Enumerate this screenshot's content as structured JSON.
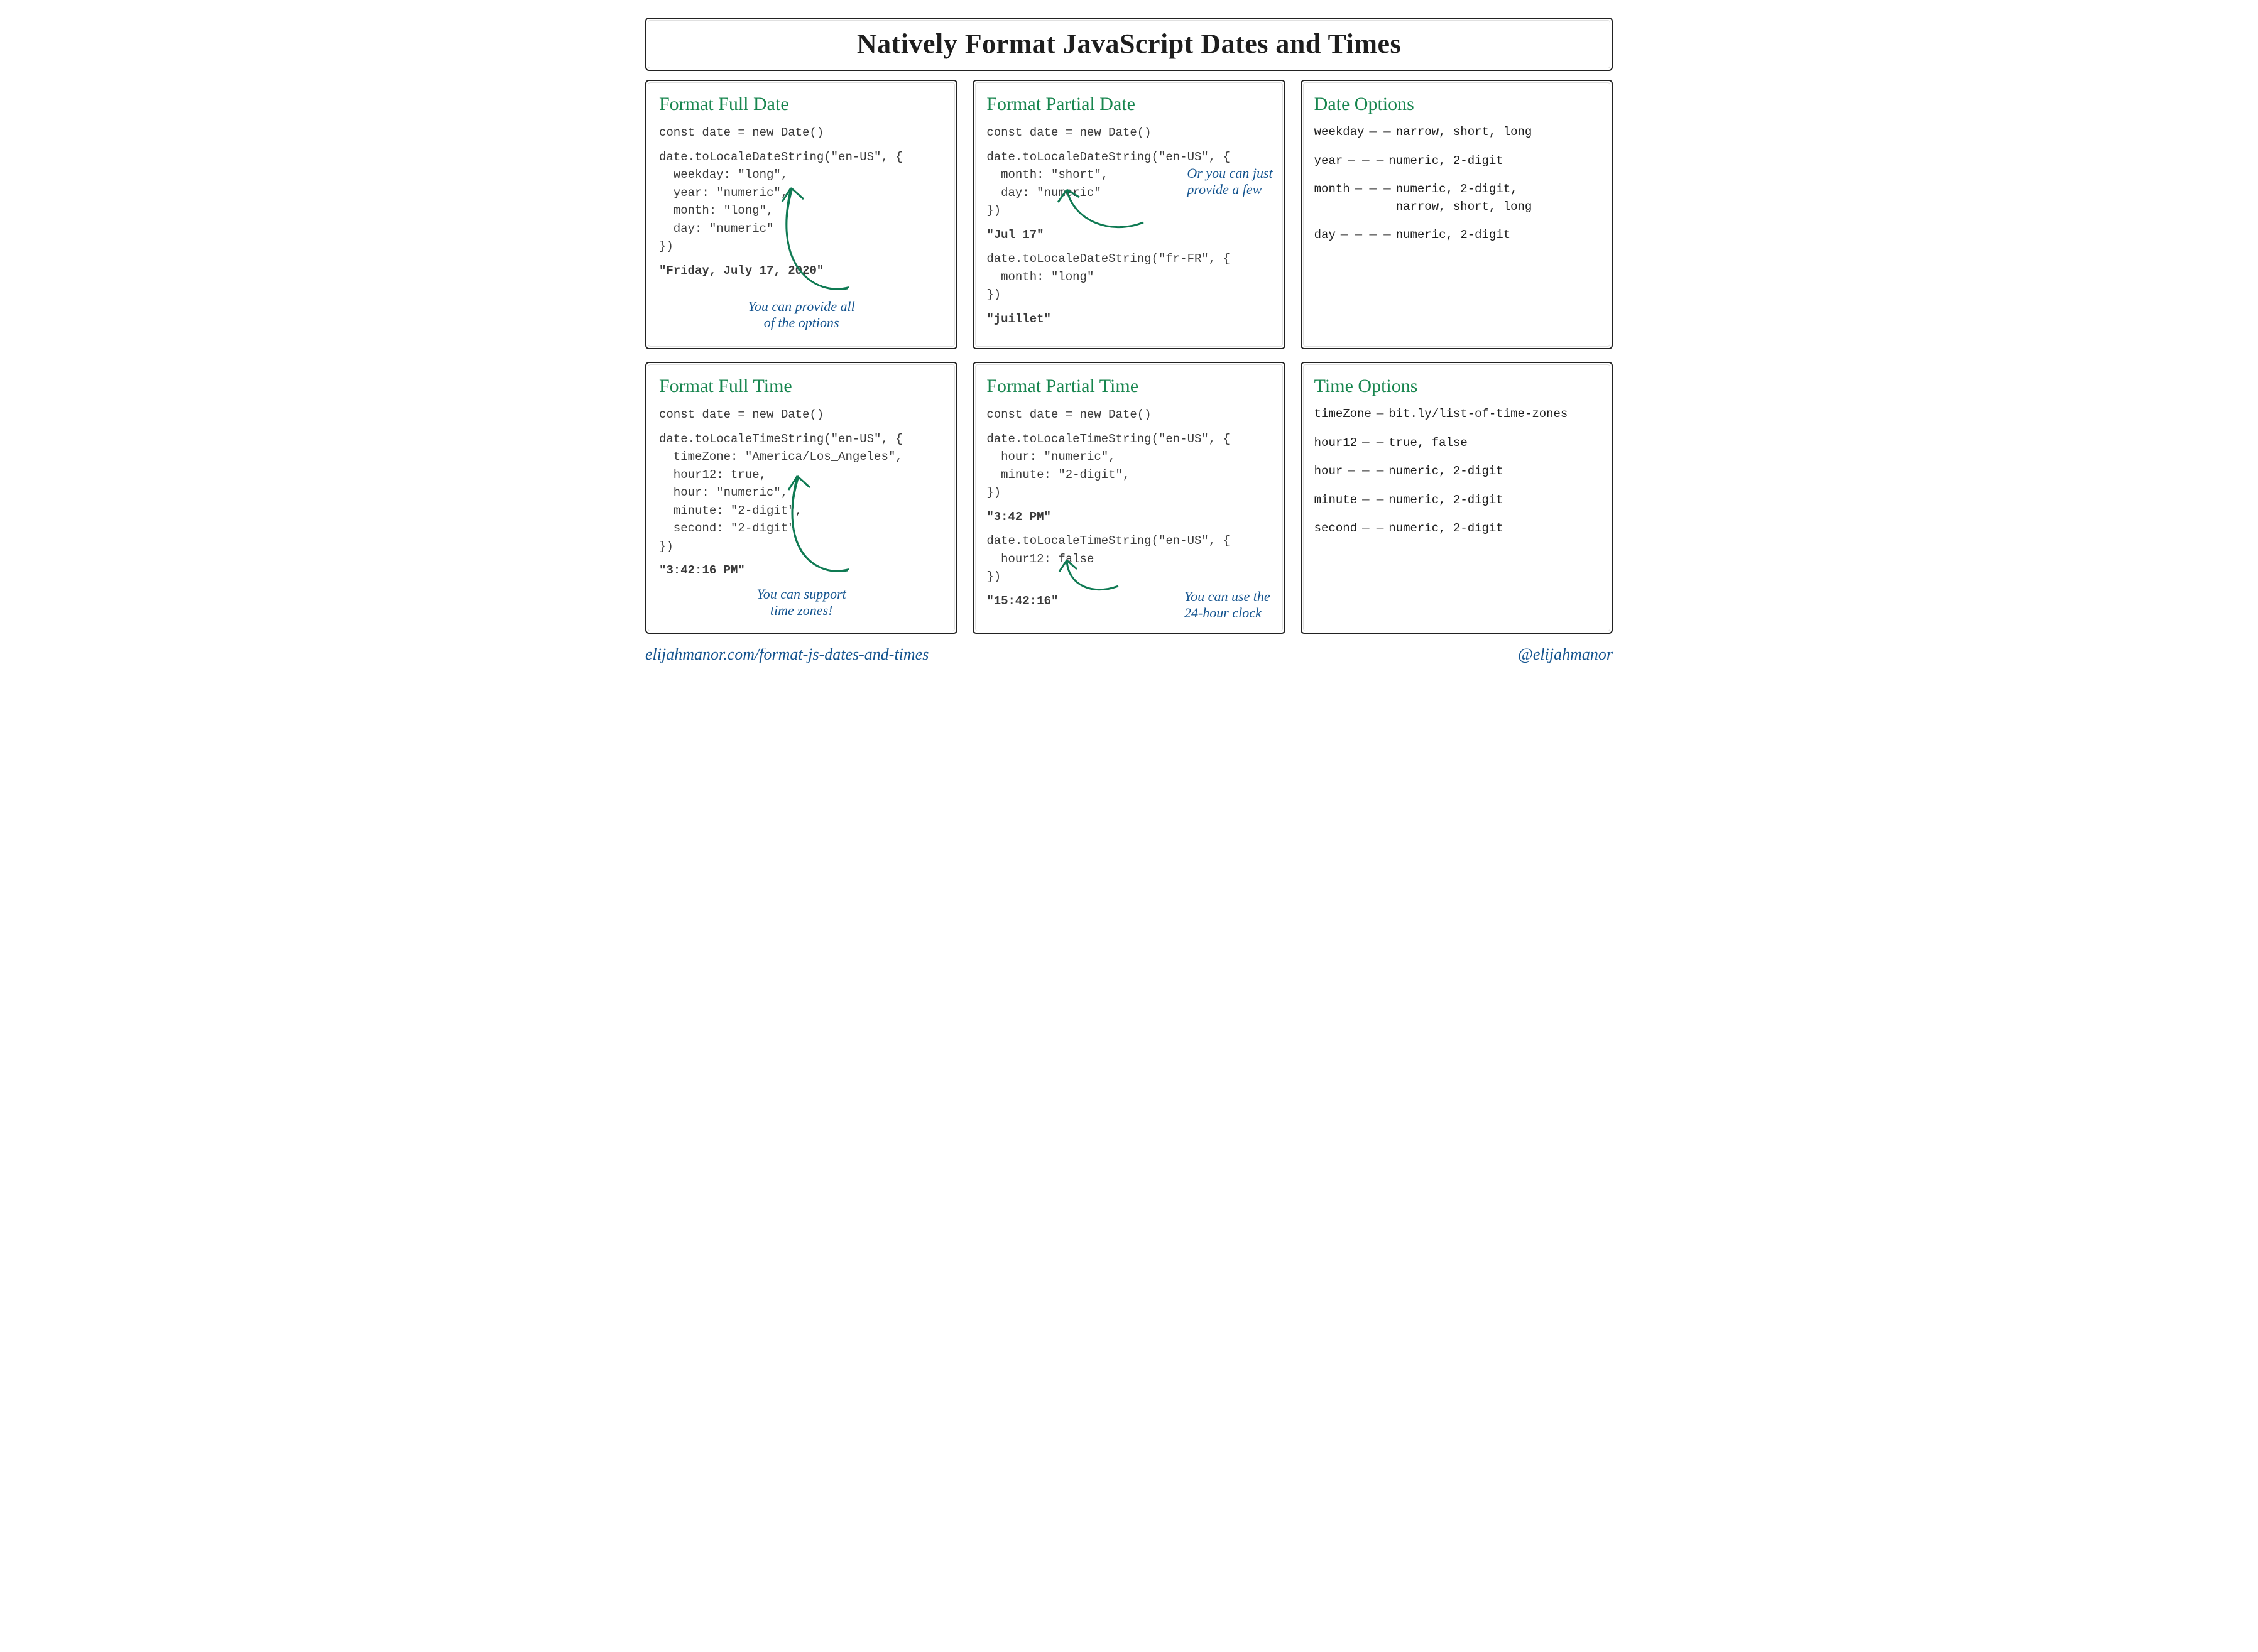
{
  "title": "Natively Format JavaScript Dates and Times",
  "footer": {
    "link": "elijahmanor.com/format-js-dates-and-times",
    "handle": "@elijahmanor"
  },
  "cards": {
    "fullDate": {
      "title": "Format Full Date",
      "decl": "const date = new Date()",
      "code": "date.toLocaleDateString(\"en-US\", {\n  weekday: \"long\",\n  year: \"numeric\",\n  month: \"long\",\n  day: \"numeric\"\n})",
      "output": "\"Friday, July 17, 2020\"",
      "note": "You can provide all\nof the options"
    },
    "partialDate": {
      "title": "Format Partial Date",
      "decl": "const date = new Date()",
      "code1": "date.toLocaleDateString(\"en-US\", {\n  month: \"short\",\n  day: \"numeric\"\n})",
      "output1": "\"Jul 17\"",
      "note": "Or you can just\nprovide a few",
      "code2": "date.toLocaleDateString(\"fr-FR\", {\n  month: \"long\"\n})",
      "output2": "\"juillet\""
    },
    "dateOptions": {
      "title": "Date Options",
      "rows": [
        {
          "key": "weekday",
          "dashes": "— —",
          "vals": "narrow, short, long"
        },
        {
          "key": "year",
          "dashes": "— — —",
          "vals": "numeric, 2-digit"
        },
        {
          "key": "month",
          "dashes": "— — —",
          "vals": "numeric, 2-digit,\nnarrow, short, long"
        },
        {
          "key": "day",
          "dashes": "— — — —",
          "vals": "numeric, 2-digit"
        }
      ]
    },
    "fullTime": {
      "title": "Format Full Time",
      "decl": "const date = new Date()",
      "code": "date.toLocaleTimeString(\"en-US\", {\n  timeZone: \"America/Los_Angeles\",\n  hour12: true,\n  hour: \"numeric\",\n  minute: \"2-digit\",\n  second: \"2-digit\"\n})",
      "output": "\"3:42:16 PM\"",
      "note": "You can support\ntime zones!"
    },
    "partialTime": {
      "title": "Format Partial Time",
      "decl": "const date = new Date()",
      "code1": "date.toLocaleTimeString(\"en-US\", {\n  hour: \"numeric\",\n  minute: \"2-digit\",\n})",
      "output1": "\"3:42 PM\"",
      "code2": "date.toLocaleTimeString(\"en-US\", {\n  hour12: false\n})",
      "output2": "\"15:42:16\"",
      "note": "You can use the\n24-hour clock"
    },
    "timeOptions": {
      "title": "Time Options",
      "rows": [
        {
          "key": "timeZone",
          "dashes": "—",
          "vals": "bit.ly/list-of-time-zones"
        },
        {
          "key": "hour12",
          "dashes": "— —",
          "vals": "true, false"
        },
        {
          "key": "hour",
          "dashes": "— — —",
          "vals": "numeric, 2-digit"
        },
        {
          "key": "minute",
          "dashes": "— —",
          "vals": "numeric, 2-digit"
        },
        {
          "key": "second",
          "dashes": "— —",
          "vals": "numeric, 2-digit"
        }
      ]
    }
  }
}
